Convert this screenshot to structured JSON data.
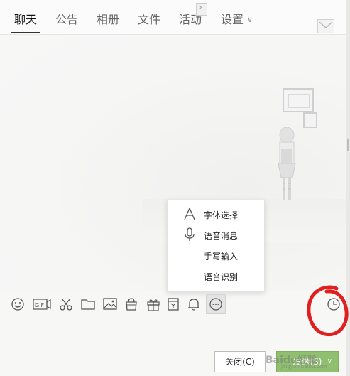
{
  "tabs": [
    {
      "label": "聊天",
      "active": true
    },
    {
      "label": "公告",
      "active": false
    },
    {
      "label": "相册",
      "active": false
    },
    {
      "label": "文件",
      "active": false
    },
    {
      "label": "活动",
      "active": false
    },
    {
      "label": "设置",
      "active": false,
      "has_dropdown": true
    }
  ],
  "menu": {
    "items": [
      {
        "label": "字体选择",
        "icon": "font-a-icon"
      },
      {
        "label": "语音消息",
        "icon": "microphone-icon"
      },
      {
        "label": "手写输入",
        "icon": ""
      },
      {
        "label": "语音识别",
        "icon": ""
      }
    ]
  },
  "toolbar": {
    "icons": [
      "emoji-icon",
      "gif-icon",
      "scissors-icon",
      "folder-icon",
      "image-icon",
      "shop-bag-icon",
      "gift-icon",
      "coupon-icon",
      "bell-icon",
      "more-icon",
      "clock-icon"
    ],
    "gif_label": "GIF"
  },
  "buttons": {
    "close": "关闭(C)",
    "send": "发送(S)"
  },
  "watermark": {
    "text": "Baidu经验",
    "sub": "jingyan.baidu.com"
  },
  "colors": {
    "send_button": "#8fbf6f",
    "annotation_circle": "#e02020",
    "active_tab": "#111111"
  }
}
